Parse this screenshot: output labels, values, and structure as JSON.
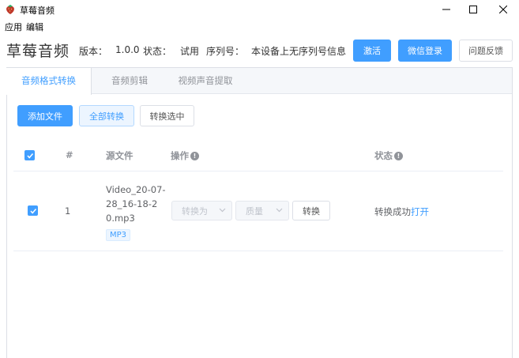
{
  "window": {
    "title": "草莓音频",
    "icons": {
      "app": "strawberry-icon",
      "minimize": "minimize-icon",
      "maximize": "maximize-icon",
      "close": "close-icon"
    }
  },
  "menu": {
    "app": "应用",
    "edit": "编辑"
  },
  "header": {
    "title": "草莓音频",
    "version_label": "版本：",
    "version_value": "1.0.0",
    "status_label": "状态：",
    "status_value": "试用",
    "serial_label": "序列号：",
    "serial_value": "本设备上无序列号信息",
    "activate": "激活",
    "wechat_login": "微信登录",
    "feedback": "问题反馈"
  },
  "tabs": [
    "音频格式转换",
    "音频剪辑",
    "视频声音提取"
  ],
  "toolbar": {
    "add_file": "添加文件",
    "convert_all": "全部转换",
    "convert_selected": "转换选中"
  },
  "table": {
    "columns": {
      "index": "#",
      "source": "源文件",
      "operation": "操作",
      "status": "状态"
    },
    "rows": [
      {
        "checked": true,
        "index": "1",
        "file": "Video_20-07-28_16-18-20.mp3",
        "format": "MP3",
        "convert_to_placeholder": "转换为",
        "quality_placeholder": "质量",
        "convert_button": "转换",
        "status": "转换成功",
        "open_link": "打开"
      }
    ]
  },
  "colors": {
    "accent": "#409eff",
    "text": "#333333",
    "muted": "#909399",
    "border": "#dcdfe6"
  }
}
